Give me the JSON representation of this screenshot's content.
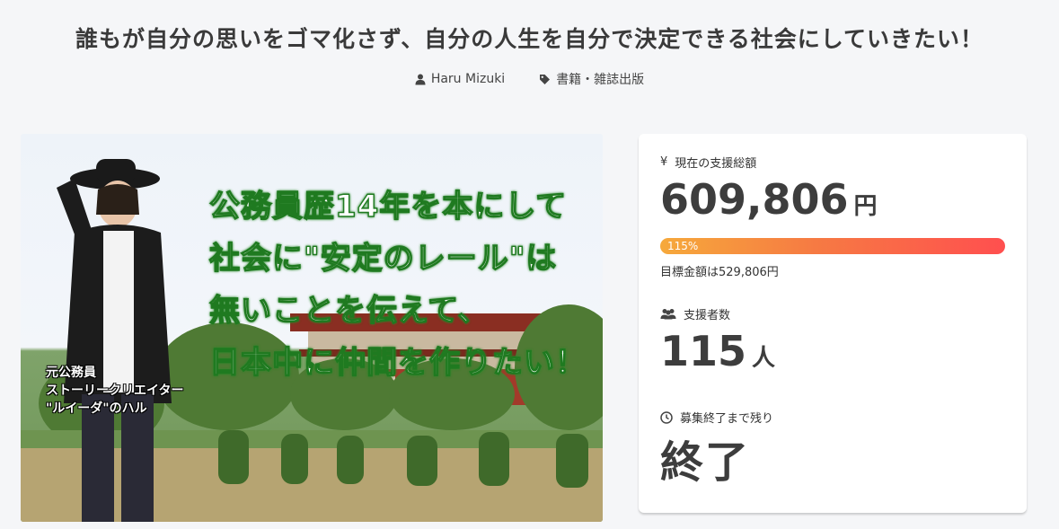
{
  "project": {
    "title": "誰もが自分の思いをゴマ化さず、自分の人生を自分で決定できる社会にしていきたい！",
    "author": "Haru Mizuki",
    "category": "書籍・雑誌出版"
  },
  "hero": {
    "headline": "公務員歴14年を本にして\n社会に\"安定のレール\"は\n無いことを伝えて、\n日本中に仲間を作りたい！",
    "caption": "元公務員\nストーリークリエイター\n\"ルイーダ\"のハル"
  },
  "stats": {
    "funding_label": "現在の支援総額",
    "currency_icon": "¥",
    "funding_amount": "609,806",
    "funding_unit": "円",
    "progress_text": "115%",
    "progress_percent": 115,
    "goal_text": "目標金額は529,806円",
    "supporters_label": "支援者数",
    "supporters_count": "115",
    "supporters_unit": "人",
    "remaining_label": "募集終了まで残り",
    "remaining_value": "終了"
  },
  "colors": {
    "progress_start": "#f6a93b",
    "progress_end": "#ff4f4f",
    "headline_outline": "#1f7a20"
  }
}
